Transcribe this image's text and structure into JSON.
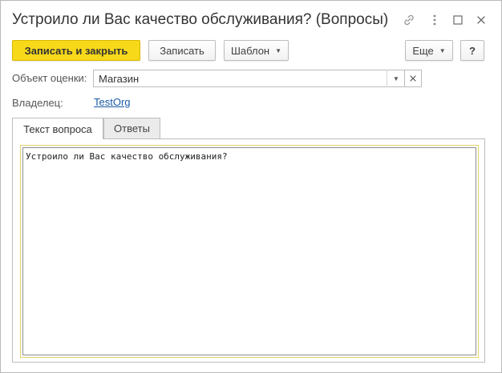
{
  "window": {
    "title": "Устроило ли Вас качество обслуживания? (Вопросы)",
    "title_icons": [
      "link-icon",
      "more-vertical-icon",
      "maximize-icon",
      "close-icon"
    ]
  },
  "toolbar": {
    "save_close_label": "Записать и закрыть",
    "save_label": "Записать",
    "template_label": "Шаблон",
    "more_label": "Еще",
    "help_label": "?"
  },
  "form": {
    "object_label": "Объект оценки:",
    "object_value": "Магазин",
    "owner_label": "Владелец:",
    "owner_value": "TestOrg"
  },
  "tabs": [
    {
      "label": "Текст вопроса",
      "active": true
    },
    {
      "label": "Ответы",
      "active": false
    }
  ],
  "question_text": "Устроило ли Вас качество обслуживания?",
  "colors": {
    "primary_button": "#f7d919",
    "link": "#1a5aa8",
    "textarea_focus_border": "#e6d16a"
  }
}
